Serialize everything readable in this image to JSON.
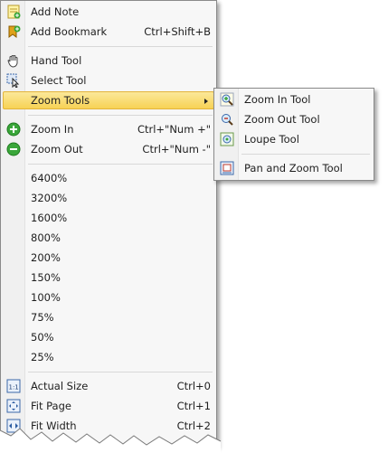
{
  "menu": {
    "add_note": {
      "label": "Add Note",
      "icon": "note-icon"
    },
    "add_bookmark": {
      "label": "Add Bookmark",
      "shortcut": "Ctrl+Shift+B",
      "icon": "bookmark-icon"
    },
    "hand_tool": {
      "label": "Hand Tool",
      "icon": "hand-icon"
    },
    "select_tool": {
      "label": "Select Tool",
      "icon": "select-icon"
    },
    "zoom_tools": {
      "label": "Zoom Tools"
    },
    "zoom_in": {
      "label": "Zoom In",
      "shortcut": "Ctrl+\"Num +\"",
      "icon": "zoom-in-green-icon"
    },
    "zoom_out": {
      "label": "Zoom Out",
      "shortcut": "Ctrl+\"Num -\"",
      "icon": "zoom-out-green-icon"
    },
    "zoom_levels": [
      "6400%",
      "3200%",
      "1600%",
      "800%",
      "200%",
      "150%",
      "100%",
      "75%",
      "50%",
      "25%"
    ],
    "actual_size": {
      "label": "Actual Size",
      "shortcut": "Ctrl+0",
      "icon": "actual-size-icon"
    },
    "fit_page": {
      "label": "Fit Page",
      "shortcut": "Ctrl+1",
      "icon": "fit-page-icon"
    },
    "fit_width": {
      "label": "Fit Width",
      "shortcut": "Ctrl+2",
      "icon": "fit-width-icon"
    }
  },
  "submenu": {
    "zoom_in_tool": {
      "label": "Zoom In Tool",
      "icon": "magnifier-plus-icon"
    },
    "zoom_out_tool": {
      "label": "Zoom Out Tool",
      "icon": "magnifier-minus-icon"
    },
    "loupe_tool": {
      "label": "Loupe Tool",
      "icon": "loupe-icon"
    },
    "pan_zoom_tool": {
      "label": "Pan and Zoom Tool",
      "icon": "pan-zoom-icon"
    }
  },
  "colors": {
    "highlight": "#f7d255",
    "highlight_border": "#e3b43a",
    "green": "#3aa63a"
  }
}
